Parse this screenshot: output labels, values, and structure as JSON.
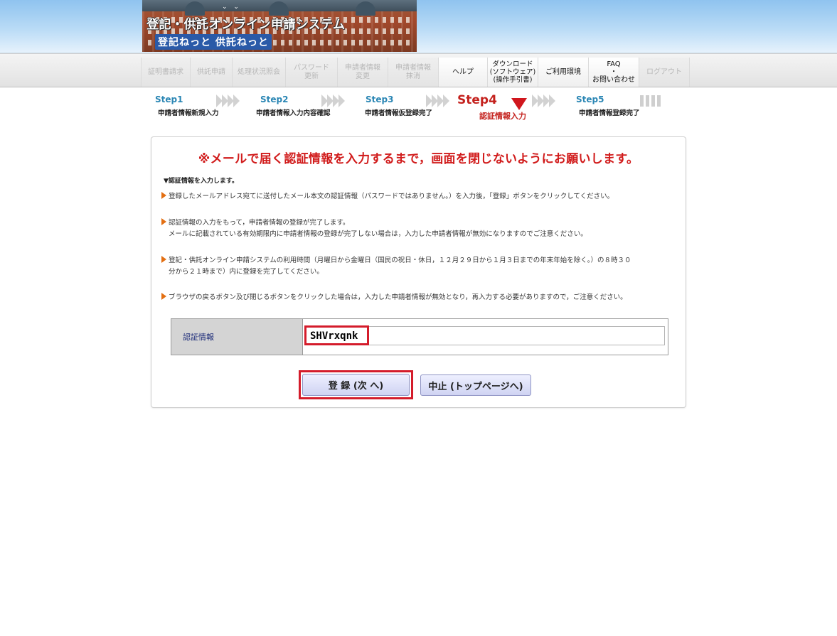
{
  "header": {
    "title_line1": "登記・供託オンライン申請システム",
    "title_line2": "登記ねっと 供託ねっと"
  },
  "menu": [
    {
      "label": "証明書請求",
      "enabled": false
    },
    {
      "label": "供託申請",
      "enabled": false
    },
    {
      "label": "処理状況照会",
      "enabled": false
    },
    {
      "label": "パスワード\n更新",
      "enabled": false
    },
    {
      "label": "申請者情報\n変更",
      "enabled": false
    },
    {
      "label": "申請者情報\n抹消",
      "enabled": false
    },
    {
      "label": "ヘルプ",
      "enabled": true
    },
    {
      "label": "ダウンロード\n(ソフトウェア)\n(操作手引書)",
      "enabled": true
    },
    {
      "label": "ご利用環境",
      "enabled": true
    },
    {
      "label": "FAQ\n・\nお問い合わせ",
      "enabled": true
    },
    {
      "label": "ログアウト",
      "enabled": false
    }
  ],
  "steps": [
    {
      "label": "Step1",
      "desc": "申請者情報新規入力"
    },
    {
      "label": "Step2",
      "desc": "申請者情報入力内容確認"
    },
    {
      "label": "Step3",
      "desc": "申請者情報仮登録完了"
    },
    {
      "label": "Step4",
      "desc": "認証情報入力",
      "current": true
    },
    {
      "label": "Step5",
      "desc": "申請者情報登録完了"
    }
  ],
  "panel": {
    "warning": "※メールで届く認証情報を入力するまで，画面を閉じないようにお願いします。",
    "subheading": "▼認証情報を入力します。",
    "paragraphs": [
      {
        "line1": "登録したメールアドレス宛てに送付したメール本文の認証情報（パスワードではありません。）を入力後，「登録」ボタンをクリックしてください。",
        "line2": ""
      },
      {
        "line1": "認証情報の入力をもって，申請者情報の登録が完了します。",
        "line2": "メールに記載されている有効期限内に申請者情報の登録が完了しない場合は，入力した申請者情報が無効になりますのでご注意ください。"
      },
      {
        "line1": "登記・供託オンライン申請システムの利用時間（月曜日から金曜日（国民の祝日・休日，１２月２９日から１月３日までの年末年始を除く。）の８時３０",
        "line2": "分から２１時まで）内に登録を完了してください。"
      },
      {
        "line1": "ブラウザの戻るボタン及び閉じるボタンをクリックした場合は，入力した申請者情報が無効となり，再入力する必要がありますので，ご注意ください。",
        "line2": ""
      }
    ],
    "auth_label": "認証情報",
    "auth_value": "SHVrxqnk",
    "register_button": "登 録 (次 へ)",
    "cancel_button": "中止 (トップページへ)"
  },
  "colors": {
    "warning": "#d11b1b",
    "step_blue": "#2a86b4",
    "step_current": "#c4211d",
    "highlight": "#d41c2b",
    "bullet": "#e36f12"
  }
}
